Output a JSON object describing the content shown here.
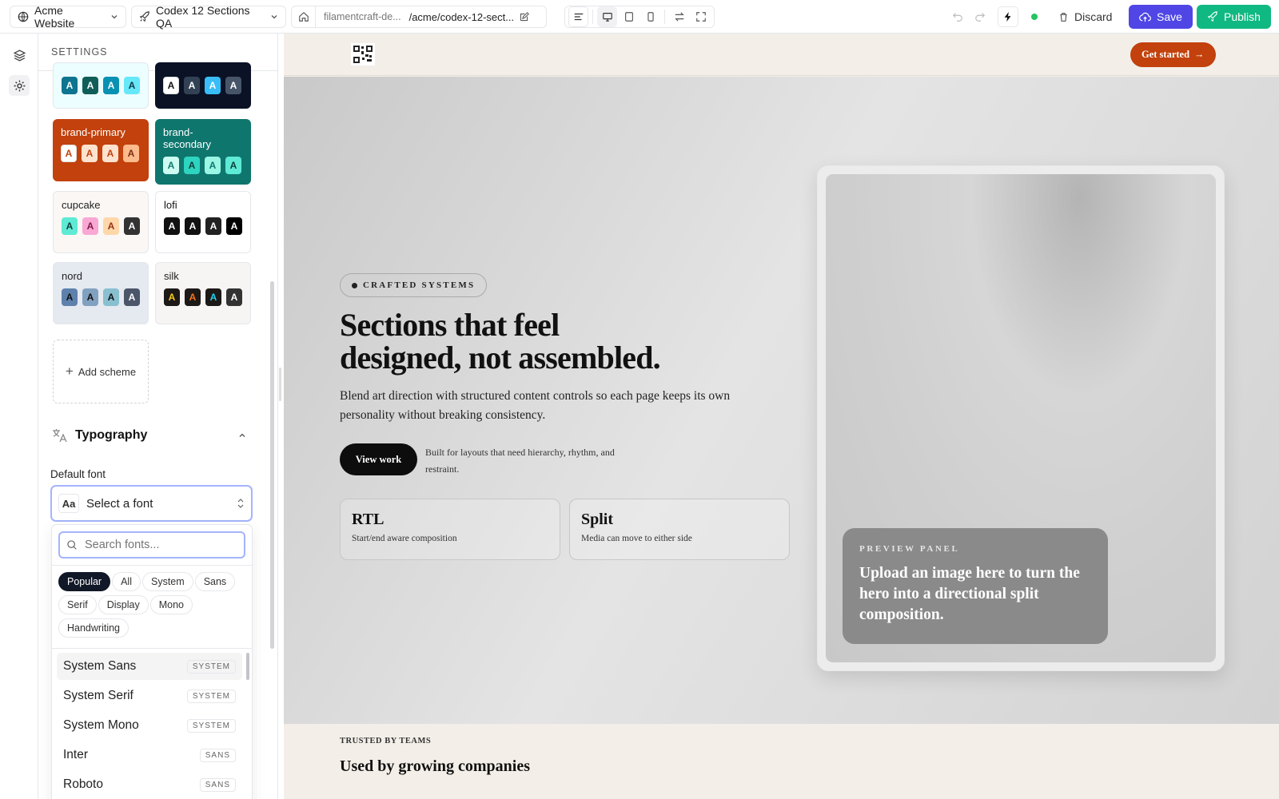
{
  "topbar": {
    "site": "Acme Website",
    "page": "Codex 12 Sections QA",
    "url_domain": "filamentcraft-de...",
    "url_path": "/acme/codex-12-sect...",
    "discard": "Discard",
    "save": "Save",
    "publish": "Publish",
    "colors": {
      "save": "#4f46e5",
      "publish": "#10b981",
      "status": "#22c55e"
    }
  },
  "panel": {
    "title": "SETTINGS",
    "schemes": [
      {
        "name": "",
        "bg": "#ecfeff",
        "text": "#111",
        "swatches": [
          [
            "#0e7490",
            "#fff"
          ],
          [
            "#115e59",
            "#fff"
          ],
          [
            "#0891b2",
            "#fff"
          ],
          [
            "#67e8f9",
            "#0e3a47"
          ]
        ]
      },
      {
        "name": "",
        "bg": "#0b1226",
        "text": "#fff",
        "swatches": [
          [
            "#ffffff",
            "#111"
          ],
          [
            "#334155",
            "#fff"
          ],
          [
            "#38bdf8",
            "#fff"
          ],
          [
            "#475569",
            "#fff"
          ]
        ]
      },
      {
        "name": "brand-primary",
        "bg": "#c2410c",
        "text": "#fff",
        "swatches": [
          [
            "#ffffff",
            "#c2410c"
          ],
          [
            "#fde3cf",
            "#c2410c"
          ],
          [
            "#fde3cf",
            "#c2410c"
          ],
          [
            "#fdba8c",
            "#7c2d12"
          ]
        ]
      },
      {
        "name": "brand-secondary",
        "bg": "#0f766e",
        "text": "#fff",
        "swatches": [
          [
            "#ccfbf1",
            "#0f766e"
          ],
          [
            "#2dd4bf",
            "#0f3d39"
          ],
          [
            "#99f6e4",
            "#0f766e"
          ],
          [
            "#5eead4",
            "#0f3d39"
          ]
        ]
      },
      {
        "name": "cupcake",
        "bg": "#faf7f5",
        "text": "#222",
        "swatches": [
          [
            "#5eead4",
            "#0f3d39"
          ],
          [
            "#f9a8d4",
            "#831843"
          ],
          [
            "#fed7aa",
            "#9a3412"
          ],
          [
            "#333",
            "#fff"
          ]
        ]
      },
      {
        "name": "lofi",
        "bg": "#ffffff",
        "text": "#111",
        "swatches": [
          [
            "#111",
            "#fff"
          ],
          [
            "#111",
            "#fff"
          ],
          [
            "#222",
            "#fff"
          ],
          [
            "#000",
            "#fff"
          ]
        ]
      },
      {
        "name": "nord",
        "bg": "#e5e9f0",
        "text": "#222",
        "swatches": [
          [
            "#5e81ac",
            "#111"
          ],
          [
            "#81a1c1",
            "#111"
          ],
          [
            "#88c0d0",
            "#111"
          ],
          [
            "#4c566a",
            "#fff"
          ]
        ]
      },
      {
        "name": "silk",
        "bg": "#f7f5f3",
        "text": "#222",
        "swatches": [
          [
            "#1c1917",
            "#facc15"
          ],
          [
            "#1c1917",
            "#f97316"
          ],
          [
            "#1c1917",
            "#22d3ee"
          ],
          [
            "#333",
            "#fff"
          ]
        ]
      }
    ],
    "swatch_letter": "A",
    "add_scheme": "Add scheme",
    "typography": "Typography",
    "default_font_label": "Default font",
    "font_select": {
      "prefix": "Aa",
      "placeholder": "Select a font"
    },
    "font_search_placeholder": "Search fonts...",
    "filters": [
      "Popular",
      "All",
      "System",
      "Sans",
      "Serif",
      "Display",
      "Mono",
      "Handwriting"
    ],
    "active_filter": "Popular",
    "fonts": [
      {
        "name": "System Sans",
        "tag": "SYSTEM"
      },
      {
        "name": "System Serif",
        "tag": "SYSTEM"
      },
      {
        "name": "System Mono",
        "tag": "SYSTEM"
      },
      {
        "name": "Inter",
        "tag": "SANS"
      },
      {
        "name": "Roboto",
        "tag": "SANS"
      }
    ]
  },
  "site": {
    "nav_cta": "Get started",
    "eyebrow": "CRAFTED SYSTEMS",
    "headline_line1": "Sections that feel",
    "headline_line2": "designed, not assembled.",
    "body": "Blend art direction with structured content controls so each page keeps its own personality without breaking consistency.",
    "primary_cta": "View work",
    "cta_note": "Built for layouts that need hierarchy, rhythm, and restraint.",
    "cards": [
      {
        "title": "RTL",
        "text": "Start/end aware composition"
      },
      {
        "title": "Split",
        "text": "Media can move to either side"
      }
    ],
    "preview_label": "PREVIEW PANEL",
    "preview_text": "Upload an image here to turn the hero into a directional split composition.",
    "trusted_label": "TRUSTED BY TEAMS",
    "trusted_title": "Used by growing companies",
    "brand_color": "#c2410c"
  }
}
